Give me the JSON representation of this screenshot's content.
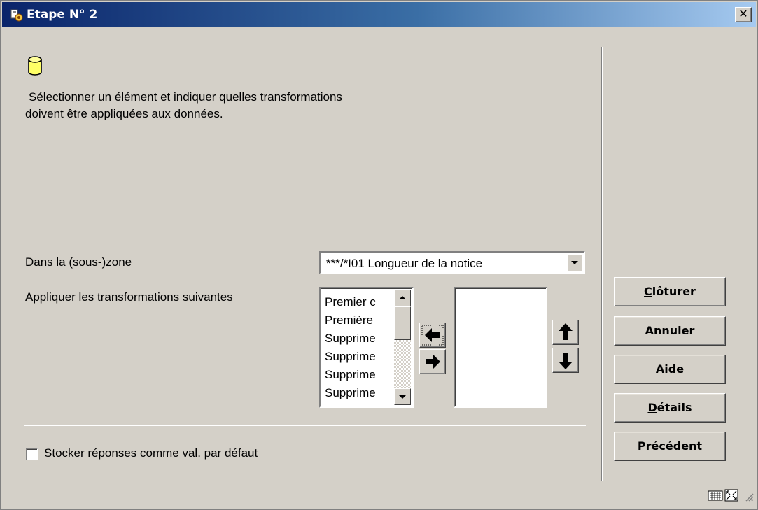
{
  "window": {
    "title": "Etape N° 2",
    "close_symbol": "✕"
  },
  "icons": {
    "title": "app-icon",
    "database": "database-icon"
  },
  "instruction_line1": "Sélectionner un élément et indiquer quelles transformations",
  "instruction_line2": "doivent être appliquées aux données.",
  "zone": {
    "label": "Dans la (sous-)zone",
    "value": "***/*I01 Longueur de la notice"
  },
  "transformations": {
    "label": "Appliquer les transformations suivantes",
    "available": [
      "Premier c",
      "Première",
      "Supprime",
      "Supprime",
      "Supprime",
      "Supprime"
    ],
    "selected": []
  },
  "store_default": {
    "label_prefix": "",
    "label_underlined": "S",
    "label_rest": "tocker réponses comme val. par défaut",
    "checked": false
  },
  "buttons": {
    "close": {
      "u": "C",
      "rest": "lôturer"
    },
    "cancel": {
      "pre": "Annuler"
    },
    "help": {
      "pre": "Ai",
      "u": "d",
      "rest": "e"
    },
    "details": {
      "u": "D",
      "rest": "étails"
    },
    "previous": {
      "u": "P",
      "rest": "récédent"
    }
  },
  "colors": {
    "title_start": "#0a246a",
    "title_end": "#a6caf0",
    "face": "#d4d0c8",
    "db_icon": "#ffff66"
  }
}
